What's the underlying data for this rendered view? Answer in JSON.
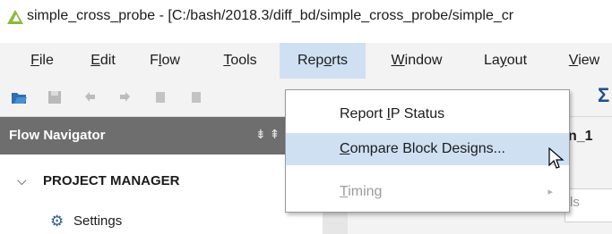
{
  "window": {
    "title": "simple_cross_probe - [C:/bash/2018.3/diff_bd/simple_cross_probe/simple_cr"
  },
  "menubar": {
    "items": [
      {
        "label": "File",
        "mnemonic": "F",
        "rest": "ile"
      },
      {
        "label": "Edit",
        "mnemonic": "E",
        "rest": "dit"
      },
      {
        "label": "Flow",
        "pre": "F",
        "mnemonic": "l",
        "rest": "ow"
      },
      {
        "label": "Tools",
        "mnemonic": "T",
        "rest": "ools"
      },
      {
        "label": "Reports",
        "pre": "Rep",
        "mnemonic": "o",
        "rest": "rts"
      },
      {
        "label": "Window",
        "mnemonic": "W",
        "rest": "indow"
      },
      {
        "label": "Layout",
        "pre": "La",
        "mnemonic": "y",
        "rest": "out"
      },
      {
        "label": "View",
        "mnemonic": "V",
        "rest": "iew"
      }
    ],
    "active": "Reports"
  },
  "toolbar": {
    "icons": [
      "open-project-icon",
      "save-icon",
      "undo-icon",
      "redo-icon",
      "copy-icon",
      "sigma-icon"
    ],
    "sigma_glyph": "Σ"
  },
  "flow_navigator": {
    "title": "Flow Navigator",
    "controls_glyph": "⇟ ⇞",
    "project_manager_label": "PROJECT MANAGER",
    "settings_label": "Settings"
  },
  "right_panel": {
    "tab_title_partial": "n_1",
    "subtab_partial": "ls"
  },
  "reports_menu": {
    "items": [
      {
        "pre": "Report ",
        "mnemonic": "I",
        "rest": "P Status",
        "state": "normal"
      },
      {
        "pre": "",
        "mnemonic": "C",
        "rest": "ompare Block Designs...",
        "state": "highlighted"
      },
      {
        "pre": "",
        "mnemonic": "T",
        "rest": "iming",
        "state": "disabled",
        "submenu_glyph": "▸"
      }
    ]
  },
  "colors": {
    "menu_highlight": "#cfe0f3",
    "flow_header": "#6e6e6e",
    "brand_accent": "#8cb83c"
  }
}
